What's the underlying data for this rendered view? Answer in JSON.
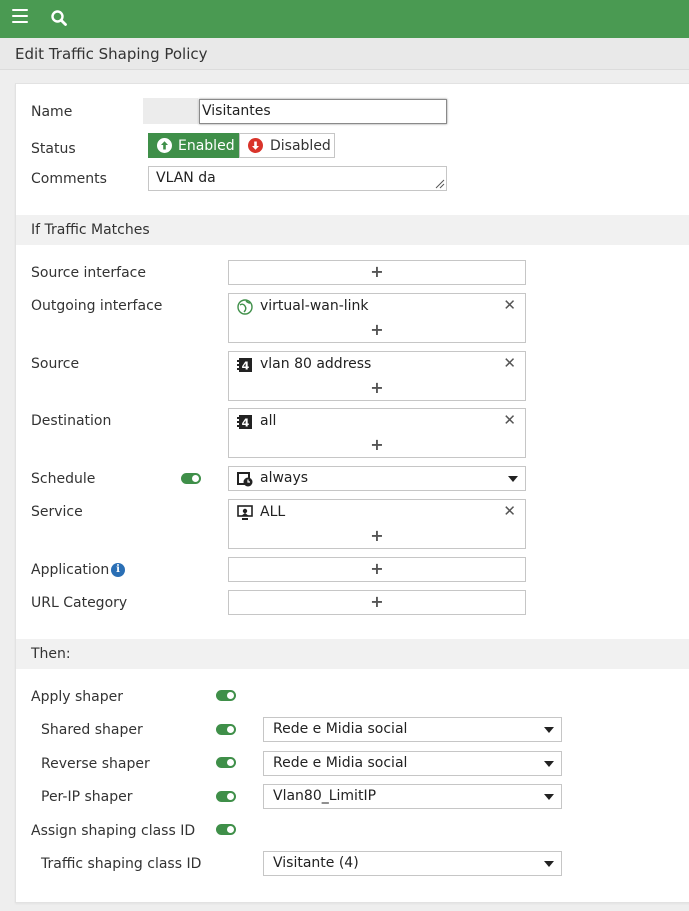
{
  "topbar": {
    "menu_icon": "hamburger-icon",
    "search_icon": "search-icon",
    "color": "#4a9a52"
  },
  "page": {
    "title": "Edit Traffic Shaping Policy"
  },
  "form": {
    "name_label": "Name",
    "name_value": "Visitantes",
    "status_label": "Status",
    "enabled_label": "Enabled",
    "disabled_label": "Disabled",
    "comments_label": "Comments",
    "comments_value": "VLAN da"
  },
  "match": {
    "section_title": "If Traffic Matches",
    "source_interface_label": "Source interface",
    "outgoing_interface_label": "Outgoing interface",
    "outgoing_interface_item": "virtual-wan-link",
    "source_label": "Source",
    "source_item": "vlan 80 address",
    "destination_label": "Destination",
    "destination_item": "all",
    "schedule_label": "Schedule",
    "schedule_value": "always",
    "service_label": "Service",
    "service_item": "ALL",
    "application_label": "Application",
    "url_category_label": "URL Category",
    "plus": "+",
    "remove": "✕"
  },
  "then": {
    "section_title": "Then:",
    "apply_shaper_label": "Apply shaper",
    "shared_shaper_label": "Shared shaper",
    "shared_shaper_value": "Rede e Midia social",
    "reverse_shaper_label": "Reverse shaper",
    "reverse_shaper_value": "Rede e Midia social",
    "per_ip_shaper_label": "Per-IP shaper",
    "per_ip_shaper_value": "Vlan80_LimitIP",
    "assign_class_label": "Assign shaping class ID",
    "traffic_class_label": "Traffic shaping class ID",
    "traffic_class_value": "Visitante (4)"
  },
  "colors": {
    "accent_green": "#3f8f49",
    "disabled_red": "#d9342b",
    "info_blue": "#2a6fb5"
  }
}
